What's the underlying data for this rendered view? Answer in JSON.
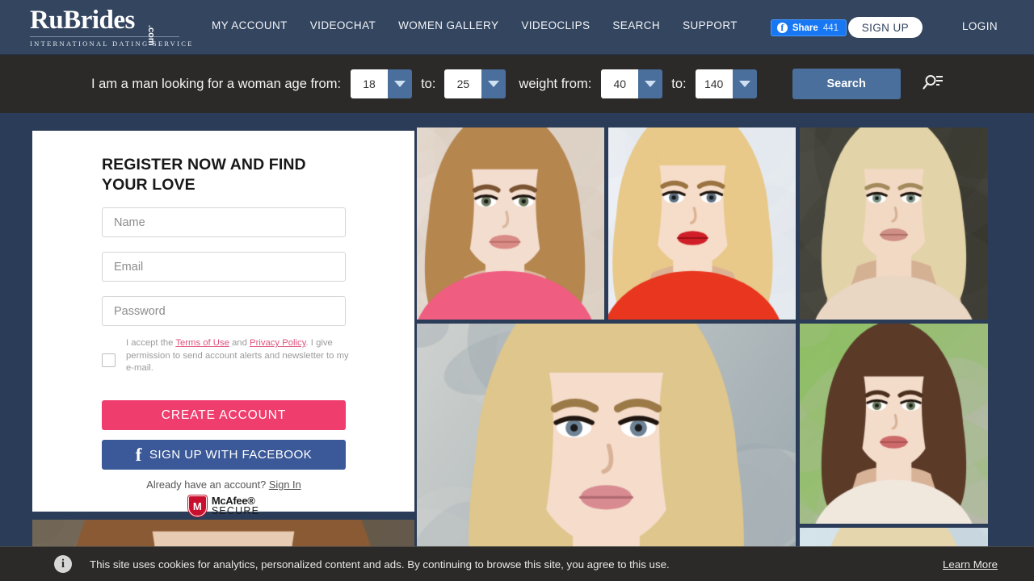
{
  "header": {
    "logo": {
      "main": "RuBride",
      "s": "s",
      "dotcom": ".com",
      "tagline": "INTERNATIONAL  DATING  SERVICE"
    },
    "nav": [
      {
        "label": "MY ACCOUNT",
        "name": "nav-my-account"
      },
      {
        "label": "VIDEOCHAT",
        "name": "nav-videochat"
      },
      {
        "label": "WOMEN GALLERY",
        "name": "nav-women-gallery"
      },
      {
        "label": "VIDEOCLIPS",
        "name": "nav-videoclips"
      },
      {
        "label": "SEARCH",
        "name": "nav-search"
      },
      {
        "label": "SUPPORT",
        "name": "nav-support"
      }
    ],
    "share": {
      "label": "Share",
      "count": "441",
      "icon": "facebook-icon"
    },
    "signup_label": "SIGN UP",
    "login_label": "LOGIN",
    "colors": {
      "header_bg": "#33455f",
      "share_bg": "#1877f2",
      "signup_bg": "#ffffff"
    }
  },
  "searchbar": {
    "lead_text": "I am a man looking for a woman age from:",
    "to_label_1": "to:",
    "weight_label": "weight from:",
    "to_label_2": "to:",
    "age_from": "18",
    "age_to": "25",
    "weight_from": "40",
    "weight_to": "140",
    "submit_label": "Search",
    "advanced_icon": "advanced-search-icon",
    "colors": {
      "bar_bg": "#2b2a28",
      "button_bg": "#4a6f9c"
    }
  },
  "register": {
    "title": "REGISTER NOW AND FIND YOUR LOVE",
    "name_placeholder": "Name",
    "email_placeholder": "Email",
    "password_placeholder": "Password",
    "terms": {
      "pre": "I accept the ",
      "link1": "Terms of Use",
      "mid": " and ",
      "link2": "Privacy Policy",
      "post": ". I give permission to send account alerts and newsletter to my e-mail."
    },
    "create_label": "CREATE ACCOUNT",
    "facebook_label": "SIGN UP WITH FACEBOOK",
    "already_text": "Already have an account? ",
    "signin_label": "Sign In",
    "mcafee": {
      "line1": "McAfee®",
      "line2": "SECURE",
      "badge_letter": "M"
    },
    "colors": {
      "create_bg": "#ef3d6e",
      "facebook_bg": "#3b5998",
      "link": "#e0527a"
    }
  },
  "gallery": {
    "photos": [
      {
        "name": "photo-thumb-1",
        "alt": "woman with long straight light-brown hair"
      },
      {
        "name": "photo-thumb-2",
        "alt": "blonde woman in red top with gold earrings"
      },
      {
        "name": "photo-thumb-3",
        "alt": "smiling blonde woman dark background"
      },
      {
        "name": "photo-feature-large",
        "alt": "close-up of blonde woman against stone wall"
      },
      {
        "name": "photo-thumb-5",
        "alt": "brunette woman with curly hair outdoors"
      },
      {
        "name": "photo-thumb-6",
        "alt": "partially visible blonde woman"
      }
    ]
  },
  "cookie": {
    "icon": "info-icon",
    "message": "This site uses cookies for analytics, personalized content and ads. By continuing to browse this site, you agree to this use.",
    "learn_more": "Learn More"
  }
}
